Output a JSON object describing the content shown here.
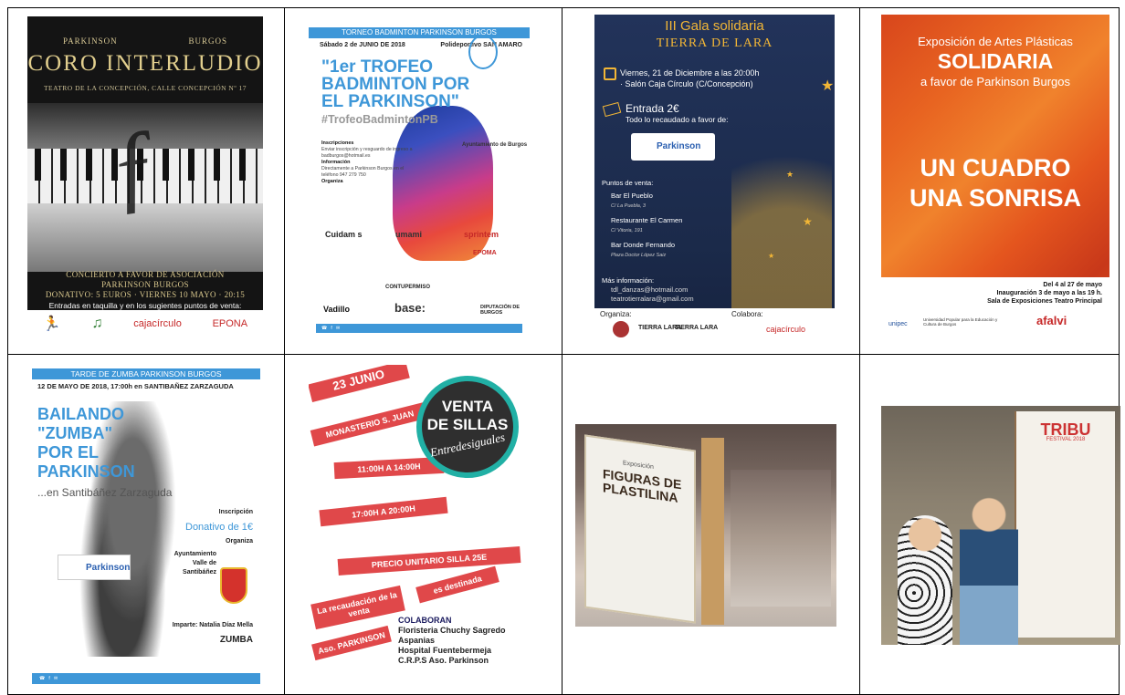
{
  "posters": {
    "coro": {
      "top_left": "PARKINSON",
      "top_right": "BURGOS",
      "title": "CORO INTERLUDIO",
      "venue": "TEATRO DE LA CONCEPCIÓN, CALLE CONCEPCIÓN Nº 17",
      "concert_line1": "CONCIERTO A FAVOR DE ASOCIACIÓN",
      "concert_line2": "PARKINSON BURGOS",
      "concert_line3": "DONATIVO: 5 EUROS · VIERNES 10 MAYO · 20:15",
      "entries": "Entradas en taquilla y en los sugientes puntos de venta:",
      "sponsors": [
        "cajacírculo",
        "EPONA"
      ]
    },
    "badminton": {
      "topbar": "TORNEO BADMINTON PARKINSON BURGOS",
      "date": "Sábado 2 de JUNIO DE 2018",
      "place": "Polideportivo SAN AMARO",
      "title": "\"1er TROFEO BADMINTON POR EL PARKINSON\"",
      "hashtag": "#TrofeoBadmintonPB",
      "inscripciones_h": "Inscripciones",
      "inscripciones_t": "Enviar inscripción y resguardo de ingreso a badburgos@hotmail.es",
      "informacion_h": "Información",
      "informacion_t": "Directamente a Parkinson Burgos en el teléfono 947 279 750",
      "organiza": "Organiza",
      "logos": [
        "Ayuntamiento de Burgos",
        "Cuidam s",
        "umami",
        "sprintem",
        "EPOMA",
        "CONTUPERMISO",
        "Vadillo",
        "base:",
        "DIPUTACIÓN DE BURGOS"
      ]
    },
    "gala": {
      "title1": "III Gala solidaria",
      "title2": "TIERRA DE LARA",
      "when1": "Viernes, 21 de Diciembre a las 20:00h",
      "when2": "· Salón Caja Círculo (C/Concepción)",
      "price": "Entrada 2€",
      "price_note": "Todo lo recaudado a favor de:",
      "pk": "Parkinson",
      "points_title": "Puntos de venta:",
      "points": [
        {
          "name": "Bar El Pueblo",
          "addr": "C/ La Puebla, 3"
        },
        {
          "name": "Restaurante El Carmen",
          "addr": "C/ Vitoria, 191"
        },
        {
          "name": "Bar Donde Fernando",
          "addr": "Plaza Doctor López Saiz"
        }
      ],
      "more": "Más información:",
      "mail1": "tdl_danzas@hotmail.com",
      "mail2": "teatrotierralara@gmail.com",
      "organiza": "Organiza:",
      "colabora": "Colabora:",
      "colabora_logo": "cajacírculo",
      "org_logos": [
        "TIERRA LARA",
        "TIERRA LARA"
      ]
    },
    "expo": {
      "l1": "Exposición de Artes Plásticas",
      "l2": "SOLIDARIA",
      "l3": "a favor de Parkinson Burgos",
      "main1": "UN CUADRO",
      "main2": "UNA SONRISA",
      "d1": "Del 4 al 27 de mayo",
      "d2": "Inauguración 3 de mayo a las 19 h.",
      "d3": "Sala de Exposiciones Teatro Principal",
      "logos": [
        "unipec",
        "Universidad Popular para la Educación y Cultura de Burgos",
        "afalvi"
      ]
    },
    "zumba": {
      "topbar": "TARDE DE ZUMBA PARKINSON BURGOS",
      "date": "12 DE MAYO DE 2018, 17:00h en SANTIBAÑEZ ZARZAGUDA",
      "title1": "BAILANDO",
      "title2": "\"ZUMBA\"",
      "title3": "POR EL",
      "title4": "PARKINSON",
      "sub": "...en Santibáñez Zarzaguda",
      "inscripcion": "Inscripción",
      "donativo": "Donativo de 1€",
      "organiza": "Organiza",
      "ayto1": "Ayuntamiento",
      "ayto2": "Valle de",
      "ayto3": "Santibáñez",
      "imparte": "Imparte: Natalia Díaz Mella",
      "pk": "Parkinson",
      "zumba": "ZUMBA"
    },
    "sillas": {
      "date": "23 JUNIO",
      "place": "MONASTERIO S. JUAN",
      "h1": "11:00H A 14:00H",
      "h2": "17:00H A 20:00H",
      "price": "PRECIO UNITARIO SILLA 25E",
      "rec1": "La recaudación de la venta",
      "rec2": "es destinada",
      "aso": "Aso. PARKINSON",
      "circle1": "VENTA",
      "circle2": "DE SILLAS",
      "circle3": "Entredesiguales",
      "colab_title": "COLABORAN",
      "colab": [
        "Floristeria Chuchy Sagredo",
        "Aspanias",
        "Hospital Fuentebermeja",
        "C.R.P.S Aso. Parkinson"
      ]
    },
    "photo1": {
      "board_text": "FIGURAS DE PLASTILINA",
      "board_small": "Exposición"
    },
    "photo2": {
      "banner": "TRIBU",
      "banner_sub": "FESTIVAL 2018"
    }
  }
}
